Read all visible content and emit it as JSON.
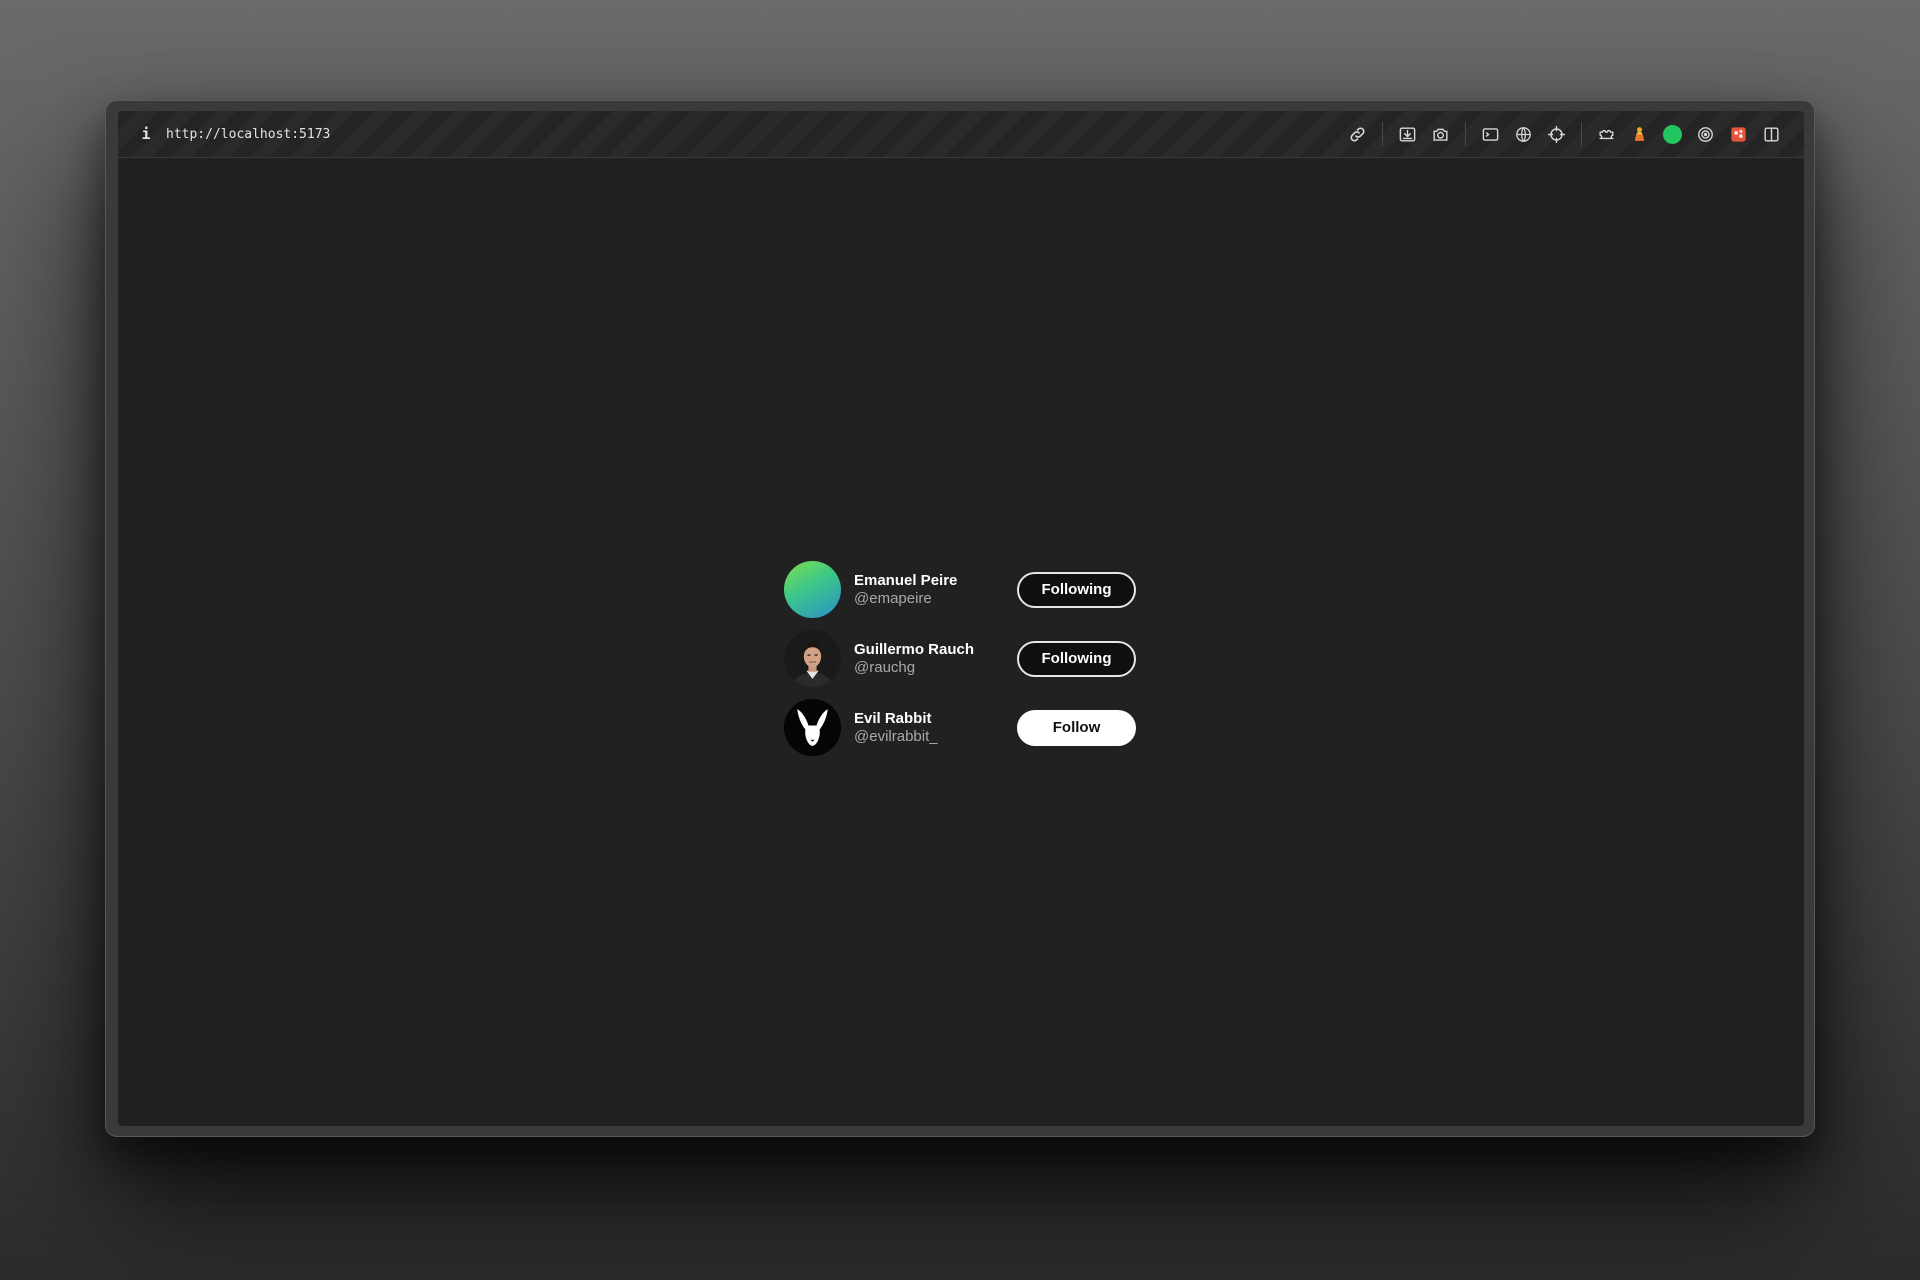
{
  "browser": {
    "url": "http://localhost:5173",
    "info_label": "i",
    "toolbar_icons": [
      "link-icon",
      "download-icon",
      "camera-icon",
      "terminal-icon",
      "globe-icon",
      "crosshair-icon",
      "extensions-icon",
      "figure-icon",
      "status-dot-icon",
      "target-icon",
      "app-icon",
      "split-view-icon"
    ],
    "status_color": "#22c55e"
  },
  "users": [
    {
      "name": "Emanuel Peire",
      "handle": "@emapeire",
      "button": "Following",
      "avatar": "gradient-avatar"
    },
    {
      "name": "Guillermo Rauch",
      "handle": "@rauchg",
      "button": "Following",
      "avatar": "photo-avatar"
    },
    {
      "name": "Evil Rabbit",
      "handle": "@evilrabbit_",
      "button": "Follow",
      "avatar": "rabbit-avatar"
    }
  ]
}
